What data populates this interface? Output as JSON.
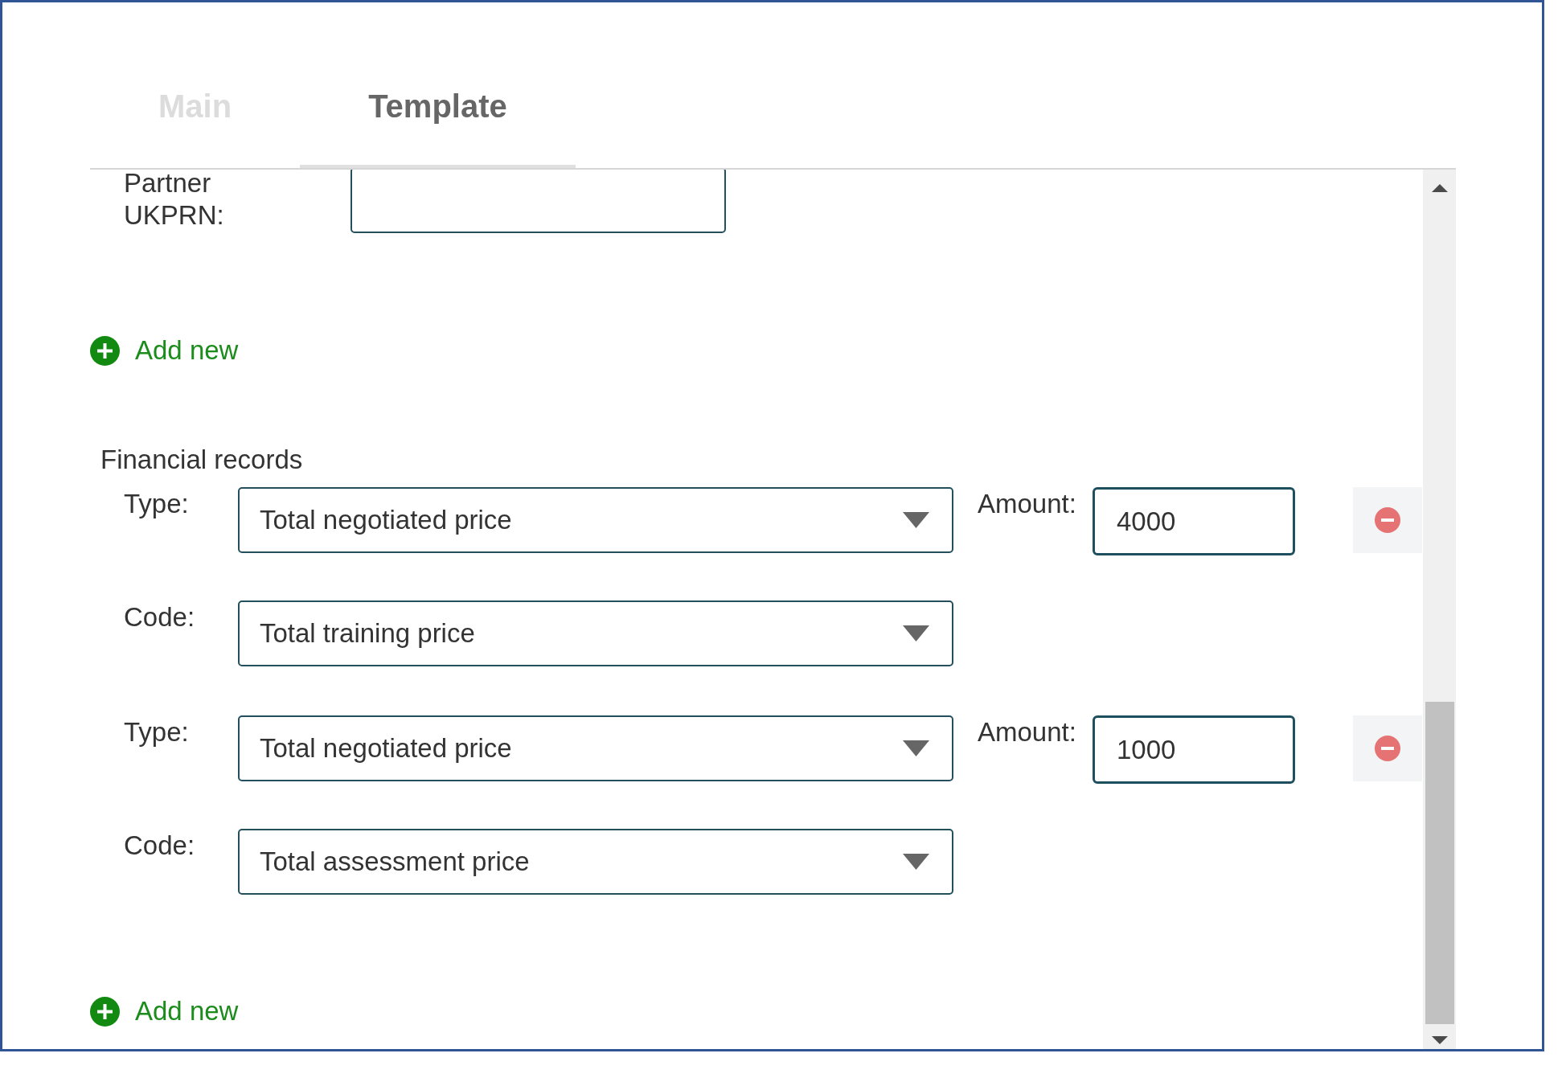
{
  "tabs": [
    {
      "label": "Main",
      "selected": false
    },
    {
      "label": "Template",
      "selected": true
    }
  ],
  "partner": {
    "ukprn_label": "Partner UKPRN:",
    "add_new": "Add new"
  },
  "financial_records": {
    "title": "Financial records",
    "records": [
      {
        "type_label": "Type:",
        "type_value": "Total negotiated price",
        "amount_label": "Amount:",
        "amount_value": "4000",
        "code_label": "Code:",
        "code_value": "Total training price"
      },
      {
        "type_label": "Type:",
        "type_value": "Total negotiated price",
        "amount_label": "Amount:",
        "amount_value": "1000",
        "code_label": "Code:",
        "code_value": "Total assessment price"
      }
    ],
    "add_new": "Add new"
  }
}
